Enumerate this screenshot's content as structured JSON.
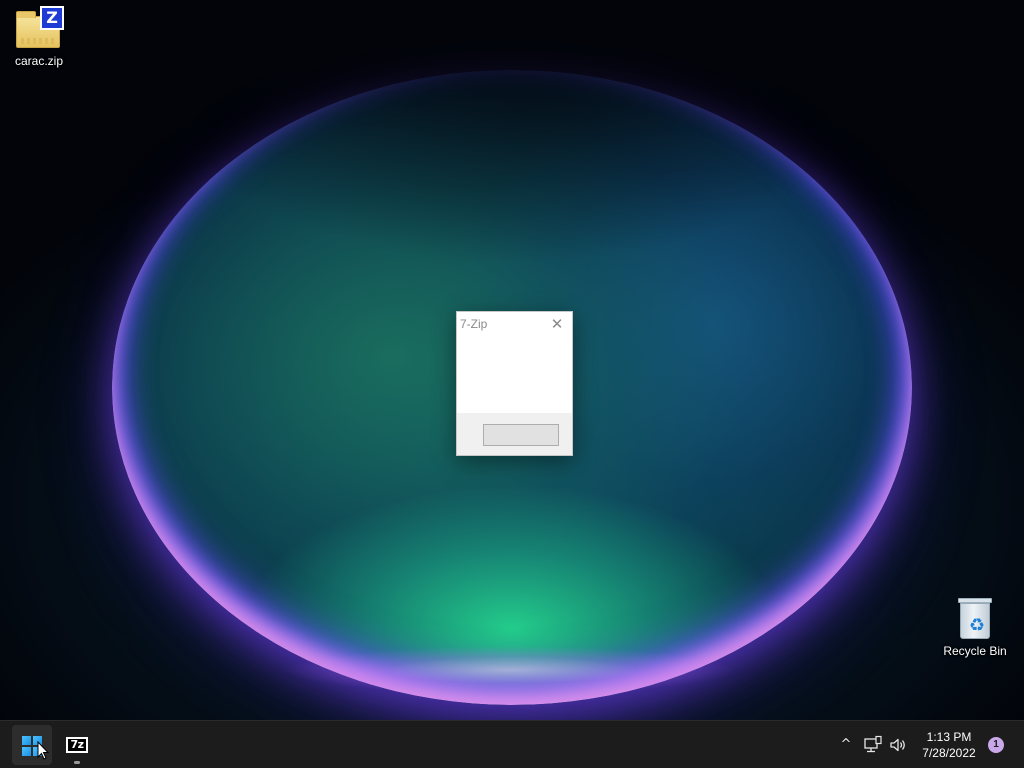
{
  "desktop": {
    "icons": [
      {
        "label": "carac.zip",
        "icon": "zip-archive-icon",
        "badge": "Z"
      },
      {
        "label": "Recycle Bin",
        "icon": "recycle-bin-icon"
      }
    ]
  },
  "dialog": {
    "title": "7-Zip",
    "close_icon": "close-icon",
    "button_label": ""
  },
  "taskbar": {
    "start_icon": "windows-logo-icon",
    "apps": [
      {
        "name": "7-Zip",
        "logo_text": "7z",
        "running": true
      }
    ],
    "tray": {
      "chevron": "^",
      "network_icon": "network-icon",
      "volume_icon": "volume-icon"
    },
    "clock": {
      "time": "1:13 PM",
      "date": "7/28/2022"
    },
    "notification_count": "1"
  },
  "colors": {
    "taskbar_bg": "#1c1c1c",
    "windows_accent": "#4cc2ff",
    "notification_badge": "#c9a8ea"
  }
}
